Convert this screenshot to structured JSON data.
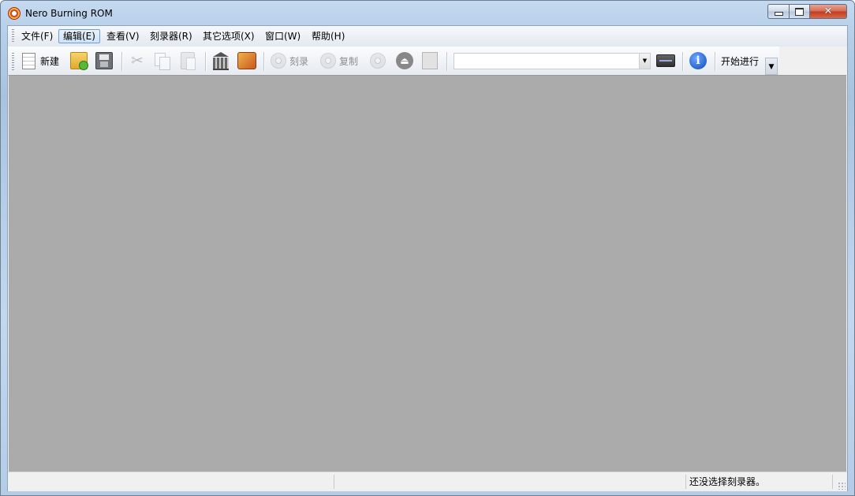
{
  "window": {
    "title": "Nero Burning ROM"
  },
  "menu": {
    "items": [
      {
        "label": "文件(F)"
      },
      {
        "label": "编辑(E)"
      },
      {
        "label": "查看(V)"
      },
      {
        "label": "刻录器(R)"
      },
      {
        "label": "其它选项(X)"
      },
      {
        "label": "窗口(W)"
      },
      {
        "label": "帮助(H)"
      }
    ],
    "active_index": 1
  },
  "toolbar": {
    "new_label": "新建",
    "burn_label": "刻录",
    "copy_label": "复制",
    "start_label": "开始进行",
    "recorder_combo_value": "",
    "icons": [
      "new-document-icon",
      "open-folder-icon",
      "save-disk-icon",
      "cut-scissors-icon",
      "copy-icon",
      "paste-icon",
      "database-icon",
      "burn-compilation-icon",
      "burn-disc-icon",
      "copy-disc-icon",
      "disc-info-icon",
      "eject-icon",
      "device-icon",
      "drive-icon",
      "info-icon"
    ]
  },
  "statusbar": {
    "pane1": "",
    "pane2": "",
    "message": "还没选择刻录器。"
  },
  "colors": {
    "workspace": "#ababab",
    "close_button": "#c2391b",
    "window_frame": "#b9d1ea"
  }
}
